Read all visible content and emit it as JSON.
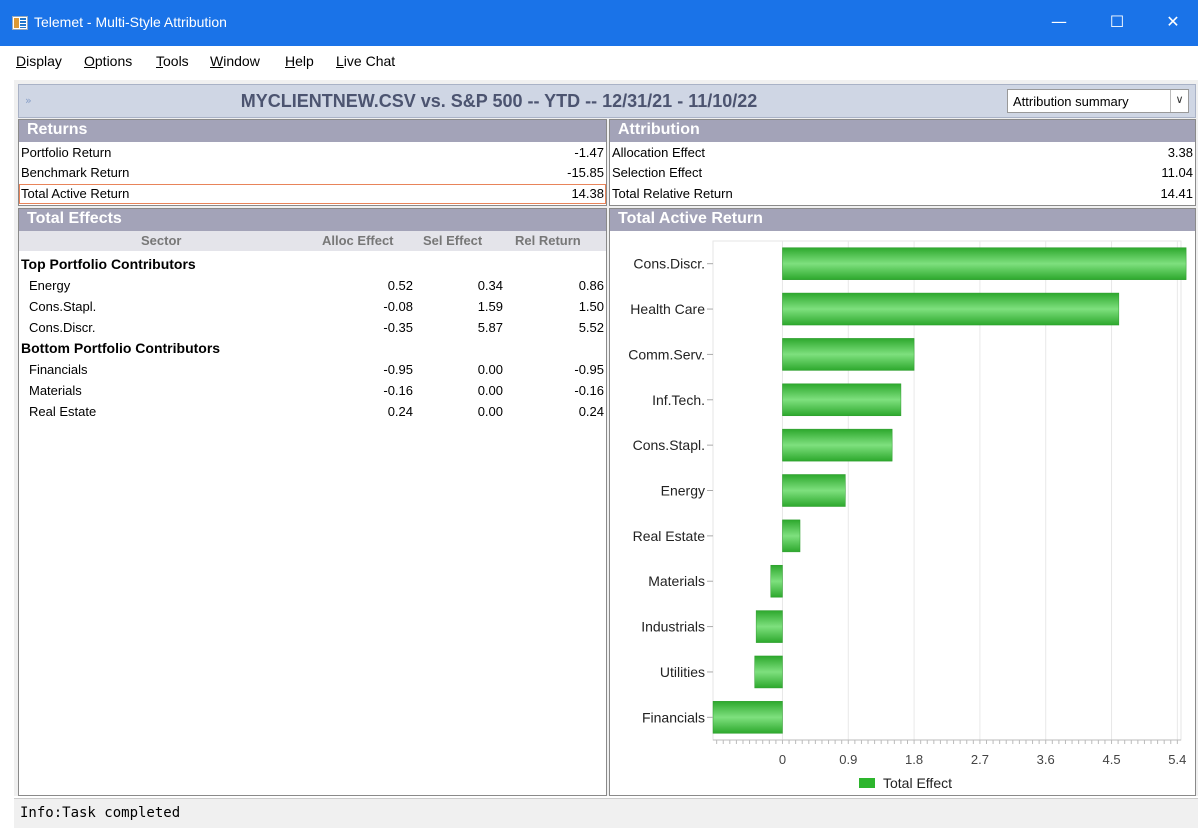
{
  "window": {
    "title": "Telemet - Multi-Style Attribution",
    "minimize": "—",
    "maximize": "☐",
    "close": "✕",
    "accent": "#1a73e8"
  },
  "menu": {
    "items": [
      {
        "label": "Display",
        "key": "D"
      },
      {
        "label": "Options",
        "key": "O"
      },
      {
        "label": "Tools",
        "key": "T"
      },
      {
        "label": "Window",
        "key": "W"
      },
      {
        "label": "Help",
        "key": "H"
      },
      {
        "label": "Live Chat",
        "key": "L"
      }
    ]
  },
  "header": {
    "expand_icon": "»",
    "title": "MYCLIENTNEW.CSV vs. S&P 500 -- YTD -- 12/31/21 - 11/10/22",
    "view_select": {
      "selected": "Attribution summary",
      "arrow": "∨"
    }
  },
  "returns": {
    "title": "Returns",
    "rows": [
      {
        "label": "Portfolio Return",
        "value": "-1.47"
      },
      {
        "label": "Benchmark Return",
        "value": "-15.85"
      },
      {
        "label": "Total Active Return",
        "value": "14.38"
      }
    ]
  },
  "attribution": {
    "title": "Attribution",
    "rows": [
      {
        "label": "Allocation Effect",
        "value": "3.38"
      },
      {
        "label": "Selection Effect",
        "value": "11.04"
      },
      {
        "label": "Total Relative Return",
        "value": "14.41"
      }
    ]
  },
  "total_effects": {
    "title": "Total Effects",
    "columns": [
      "Sector",
      "Alloc Effect",
      "Sel Effect",
      "Rel Return"
    ],
    "groups": [
      {
        "name": "Top Portfolio Contributors",
        "rows": [
          {
            "sector": "Energy",
            "alloc": "0.52",
            "sel": "0.34",
            "rel": "0.86"
          },
          {
            "sector": "Cons.Stapl.",
            "alloc": "-0.08",
            "sel": "1.59",
            "rel": "1.50"
          },
          {
            "sector": "Cons.Discr.",
            "alloc": "-0.35",
            "sel": "5.87",
            "rel": "5.52"
          }
        ]
      },
      {
        "name": "Bottom Portfolio Contributors",
        "rows": [
          {
            "sector": "Financials",
            "alloc": "-0.95",
            "sel": "0.00",
            "rel": "-0.95"
          },
          {
            "sector": "Materials",
            "alloc": "-0.16",
            "sel": "0.00",
            "rel": "-0.16"
          },
          {
            "sector": "Real Estate",
            "alloc": "0.24",
            "sel": "0.00",
            "rel": "0.24"
          }
        ]
      }
    ]
  },
  "chart_panel": {
    "title": "Total Active Return"
  },
  "chart_data": {
    "type": "bar",
    "orientation": "horizontal",
    "categories": [
      "Cons.Discr.",
      "Health Care",
      "Comm.Serv.",
      "Inf.Tech.",
      "Cons.Stapl.",
      "Energy",
      "Real Estate",
      "Materials",
      "Industrials",
      "Utilities",
      "Financials"
    ],
    "series": [
      {
        "name": "Total Effect",
        "values": [
          5.52,
          4.6,
          1.8,
          1.62,
          1.5,
          0.86,
          0.24,
          -0.16,
          -0.36,
          -0.38,
          -0.95
        ],
        "color": "#2db52d"
      }
    ],
    "xticks": [
      "0",
      "0.9",
      "1.8",
      "2.7",
      "3.6",
      "4.5",
      "5.4"
    ],
    "xlim": [
      -0.95,
      5.45
    ],
    "grid": true,
    "legend": "bottom"
  },
  "status": {
    "text": "Info:Task completed"
  }
}
